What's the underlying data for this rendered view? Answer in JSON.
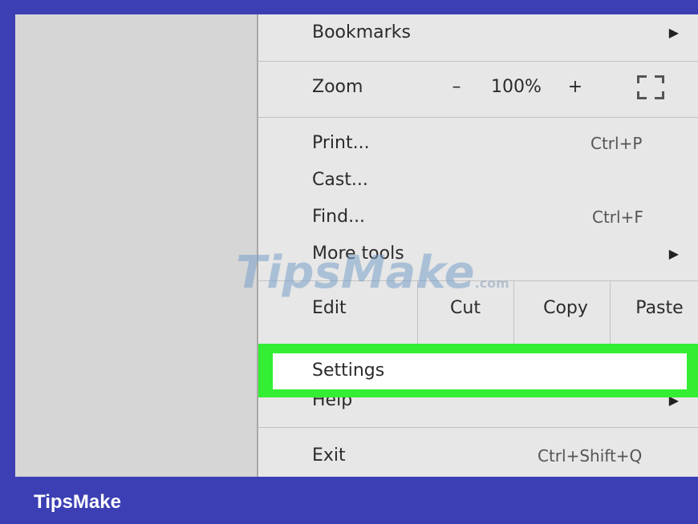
{
  "menu": {
    "bookmarks": {
      "label": "Bookmarks",
      "icon": "submenu-arrow-icon"
    },
    "zoom": {
      "label": "Zoom",
      "minus": "–",
      "value": "100%",
      "plus": "+",
      "fullscreen_icon": "fullscreen-icon"
    },
    "print": {
      "label": "Print...",
      "shortcut": "Ctrl+P"
    },
    "cast": {
      "label": "Cast..."
    },
    "find": {
      "label": "Find...",
      "shortcut": "Ctrl+F"
    },
    "more_tools": {
      "label": "More tools",
      "icon": "submenu-arrow-icon"
    },
    "edit": {
      "label": "Edit",
      "cut": "Cut",
      "copy": "Copy",
      "paste": "Paste"
    },
    "settings": {
      "label": "Settings",
      "highlight_color": "#33ee33"
    },
    "help": {
      "label": "Help",
      "icon": "submenu-arrow-icon"
    },
    "exit": {
      "label": "Exit",
      "shortcut": "Ctrl+Shift+Q"
    }
  },
  "watermark": {
    "text": "TipsMake",
    "suffix": ".com"
  },
  "footer": {
    "brand": "TipsMake"
  },
  "colors": {
    "frame": "#3b3fb3",
    "menu_bg": "#e7e7e7",
    "highlight": "#33ee33"
  }
}
